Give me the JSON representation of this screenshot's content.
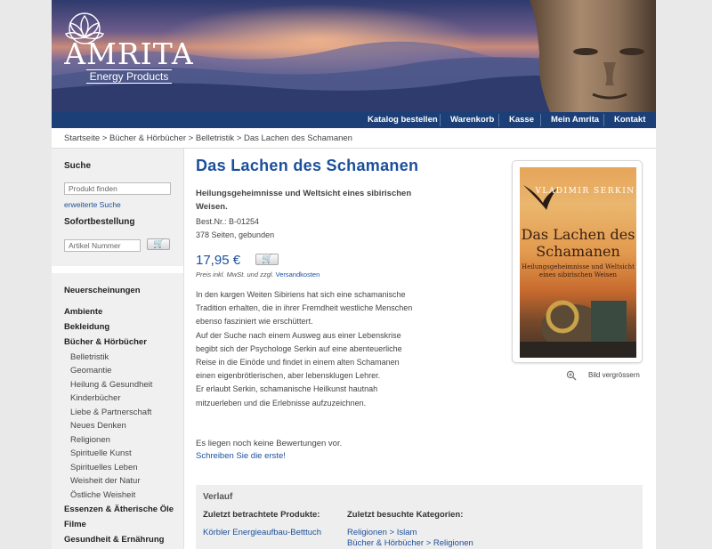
{
  "brand": {
    "name": "AMRITA",
    "tagline": "Energy Products"
  },
  "nav": [
    "Katalog bestellen",
    "Warenkorb",
    "Kasse",
    "Mein Amrita",
    "Kontakt"
  ],
  "breadcrumb": "Startseite > Bücher & Hörbücher > Belletristik > Das Lachen des Schamanen",
  "sidebar": {
    "search_heading": "Suche",
    "search_placeholder": "Produkt finden",
    "advanced_search": "erweiterte Suche",
    "quickorder_heading": "Sofortbestellung",
    "article_placeholder": "Artikel Nummer",
    "new_releases": "Neuerscheinungen",
    "categories": [
      {
        "label": "Ambiente"
      },
      {
        "label": "Bekleidung"
      },
      {
        "label": "Bücher & Hörbücher",
        "children": [
          "Belletristik",
          "Geomantie",
          "Heilung & Gesundheit",
          "Kinderbücher",
          "Liebe & Partnerschaft",
          "Neues Denken",
          "Religionen",
          "Spirituelle Kunst",
          "Spirituelles Leben",
          "Weisheit der Natur",
          "Östliche Weisheit"
        ]
      },
      {
        "label": "Essenzen & Ätherische Öle"
      },
      {
        "label": "Filme"
      },
      {
        "label": "Gesundheit & Ernährung"
      }
    ]
  },
  "product": {
    "title": "Das Lachen des Schamanen",
    "subtitle": "Heilungsgeheimnisse und Weltsicht eines sibirischen Weisen.",
    "order_number": "Best.Nr.: B-01254",
    "format": "378 Seiten, gebunden",
    "price": "17,95 €",
    "price_note": "Preis inkl. MwSt. und zzgl.",
    "shipping_link": "Versandkosten",
    "description": [
      "In den kargen Weiten Sibiriens hat sich eine schamanische Tradition erhalten, die in ihrer Fremdheit westliche Menschen ebenso fasziniert wie erschüttert.",
      "Auf der Suche nach einem Ausweg aus einer Lebenskrise begibt sich der Psychologe Serkin auf eine abenteuerliche Reise in die Einöde und findet in einem alten Schamanen einen eigenbrötlerischen, aber lebensklugen Lehrer.",
      "Er erlaubt Serkin, schamanische Heilkunst hautnah mitzuerleben und die Erlebnisse aufzuzeichnen."
    ],
    "no_reviews": "Es liegen noch keine Bewertungen vor.",
    "write_review": "Schreiben Sie die erste!",
    "cover": {
      "author": "VLADIMIR SERKIN",
      "title": "Das Lachen des Schamanen",
      "subtitle": "Heilungsgeheimnisse und Weltsicht eines sibirischen Weisen"
    },
    "enlarge": "Bild vergrössern"
  },
  "history": {
    "heading": "Verlauf",
    "products_heading": "Zuletzt betrachtete Produkte:",
    "products": [
      "Körbler Energieaufbau-Betttuch"
    ],
    "categories_heading": "Zuletzt besuchte Kategorien:",
    "categories": [
      "Religionen > Islam",
      "Bücher & Hörbücher > Religionen"
    ]
  },
  "colors": {
    "accent": "#1b4f9c",
    "navbar": "#1b3f76"
  }
}
